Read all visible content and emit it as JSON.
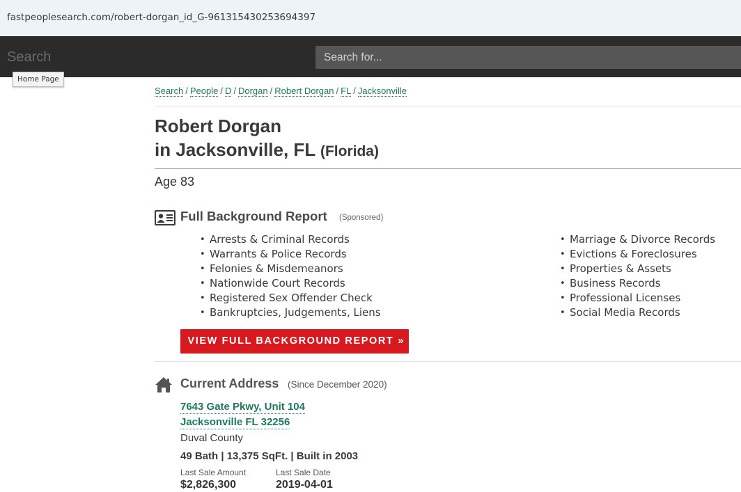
{
  "browser": {
    "url": "fastpeoplesearch.com/robert-dorgan_id_G-961315430253694397"
  },
  "nav": {
    "brand": "Search",
    "search_placeholder": "Search for...",
    "tooltip": "Home Page"
  },
  "breadcrumb": [
    {
      "label": "Search"
    },
    {
      "label": "People"
    },
    {
      "label": "D"
    },
    {
      "label": "Dorgan"
    },
    {
      "label": "Robert Dorgan"
    },
    {
      "label": "FL"
    },
    {
      "label": "Jacksonville"
    }
  ],
  "person": {
    "name": "Robert Dorgan",
    "location": "in Jacksonville, FL",
    "state_full": "(Florida)",
    "age": "Age 83"
  },
  "background": {
    "title": "Full Background Report",
    "sponsored": "(Sponsored)",
    "icon": "id-card-icon",
    "left_items": [
      "Arrests & Criminal Records",
      "Warrants & Police Records",
      "Felonies & Misdemeanors",
      "Nationwide Court Records",
      "Registered Sex Offender Check",
      "Bankruptcies, Judgements, Liens"
    ],
    "right_items": [
      "Marriage & Divorce Records",
      "Evictions & Foreclosures",
      "Properties & Assets",
      "Business Records",
      "Professional Licenses",
      "Social Media Records"
    ],
    "cta_label": "VIEW FULL BACKGROUND REPORT",
    "cta_chevron": "»",
    "cta_color": "#d8191f"
  },
  "address": {
    "title": "Current Address",
    "since": "(Since December 2020)",
    "icon": "home-icon",
    "line1": "7643 Gate Pkwy, Unit 104",
    "line2": "Jacksonville FL 32256",
    "county": "Duval County",
    "facts": "49 Bath | 13,375 SqFt. | Built in 2003",
    "last_sale_amount_label": "Last Sale Amount",
    "last_sale_amount": "$2,826,300",
    "last_sale_date_label": "Last Sale Date",
    "last_sale_date": "2019-04-01"
  },
  "colors": {
    "link": "#1b7a5d",
    "nav_bg": "#2b2b2b",
    "url_bg": "#eef3f8"
  }
}
